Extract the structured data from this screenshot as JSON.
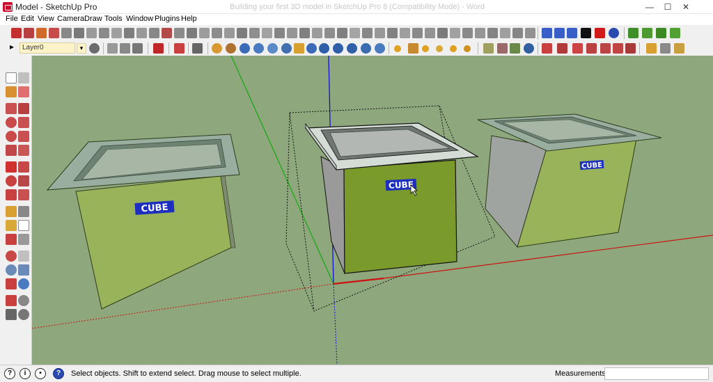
{
  "window": {
    "title": "Model - SketchUp Pro",
    "ghost_title": "Building your first 3D model in SketchUp Pro 8 (Compatibility Mode) - Word",
    "minimize": "—",
    "maximize": "☐",
    "close": "✕"
  },
  "menu": [
    "File",
    "Edit",
    "View",
    "Camera",
    "Draw",
    "Tools",
    "Window",
    "Plugins",
    "Help"
  ],
  "toolbar": {
    "layer_value": "Layer0"
  },
  "scene": {
    "labels": [
      "CUBE",
      "CUBE",
      "CUBE"
    ],
    "colors": {
      "background": "#8fa77c",
      "front_face": "#98b35a",
      "front_face_selected": "#7a9a2c",
      "side_face": "#9a9a9a",
      "top_rim": "#9cb0a0",
      "label_bg": "#1c2fbf",
      "axis_red": "#cc1111",
      "axis_green": "#11aa11",
      "axis_blue": "#1111cc"
    }
  },
  "status": {
    "hint": "Select objects. Shift to extend select. Drag mouse to select multiple.",
    "measurements_label": "Measurements",
    "measurements_value": ""
  }
}
